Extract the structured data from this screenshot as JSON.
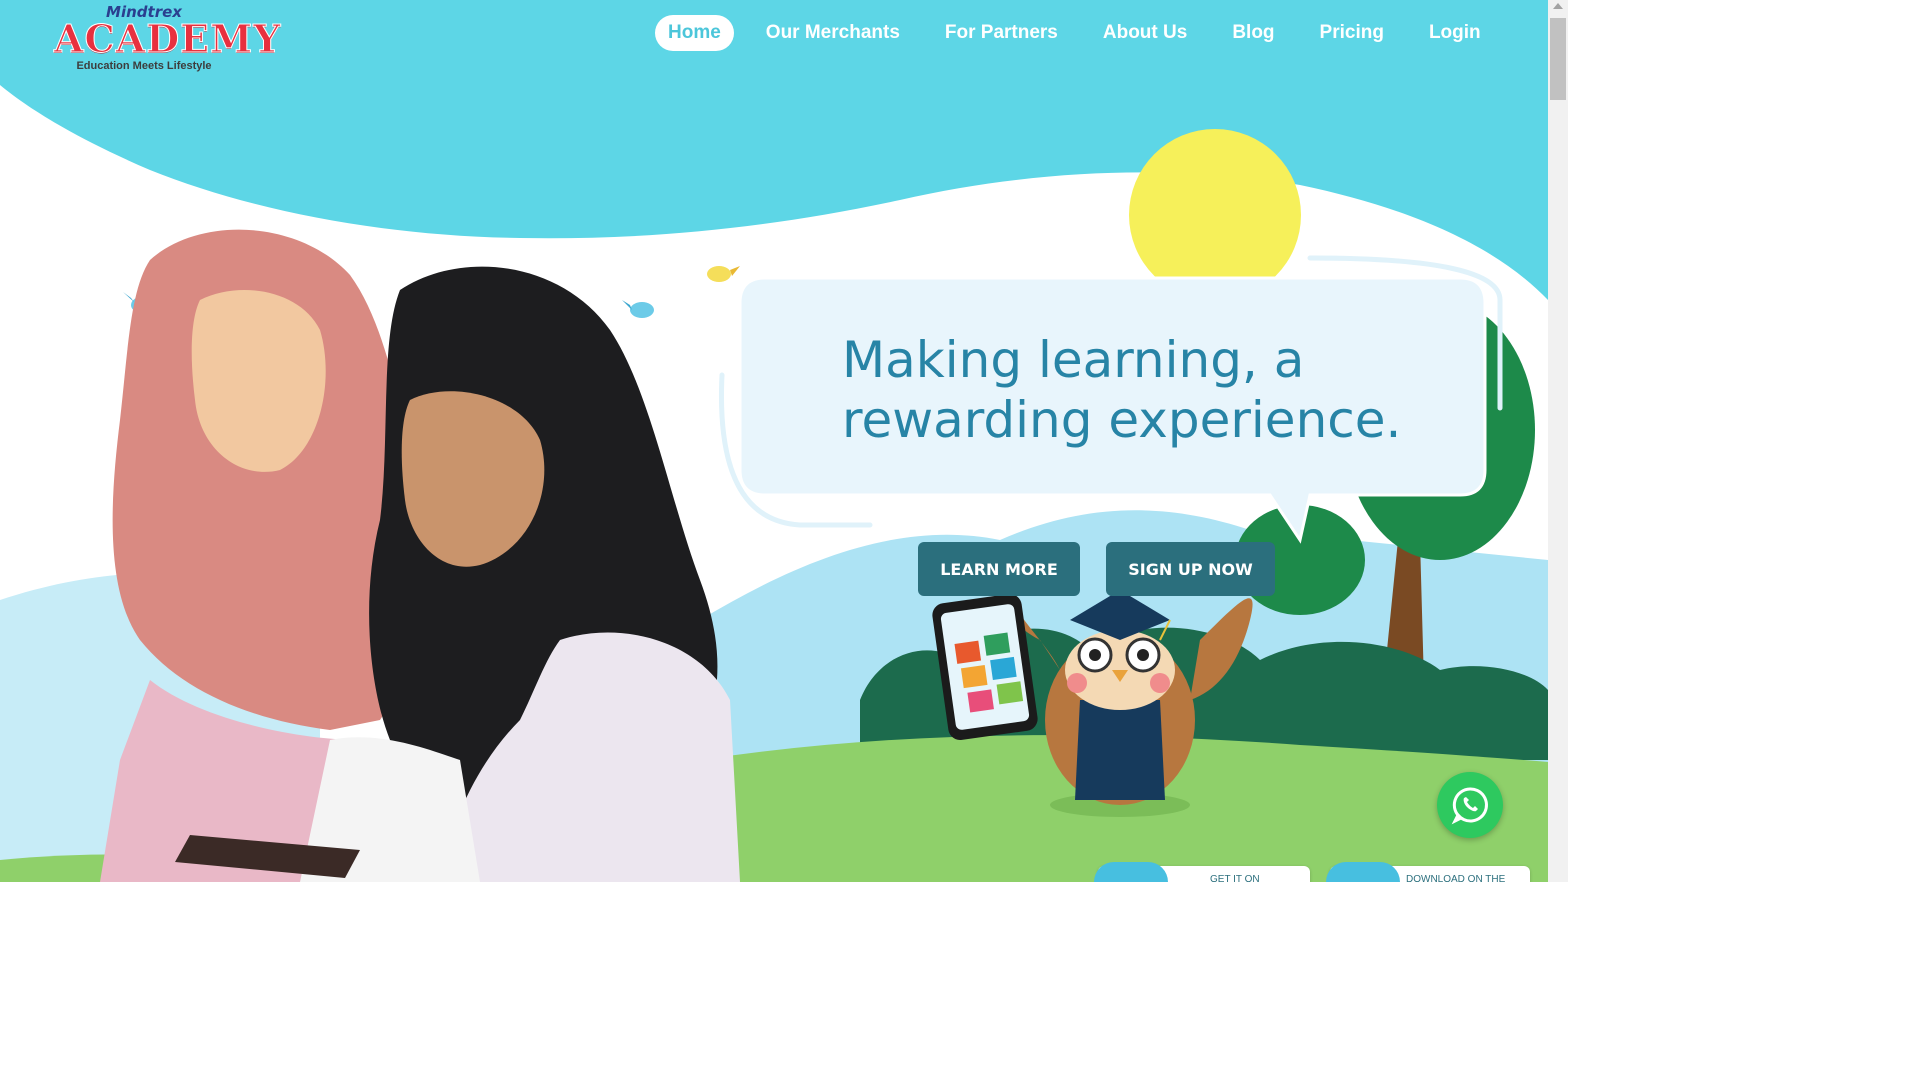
{
  "brand": {
    "top": "Mindtrex",
    "main": "ACADEMY",
    "tagline": "Education Meets Lifestyle"
  },
  "nav": {
    "items": [
      {
        "label": "Home",
        "active": true
      },
      {
        "label": "Our Merchants",
        "active": false
      },
      {
        "label": "For Partners",
        "active": false
      },
      {
        "label": "About Us",
        "active": false
      },
      {
        "label": "Blog",
        "active": false
      },
      {
        "label": "Pricing",
        "active": false
      },
      {
        "label": "Login",
        "active": false
      }
    ]
  },
  "hero": {
    "headline_line1": "Making learning, a",
    "headline_line2": "rewarding experience.",
    "learn_more": "LEARN MORE",
    "sign_up": "SIGN UP NOW"
  },
  "stores": {
    "google_play_label": "GET IT ON",
    "app_store_label": "DOWNLOAD ON THE"
  },
  "icons": {
    "whatsapp": "whatsapp-icon"
  },
  "colors": {
    "sky": "#5dd6e6",
    "accent_teal": "#2b6f7d",
    "headline": "#2784a6",
    "logo_red": "#e8303f",
    "whatsapp_green": "#2ec95f"
  }
}
